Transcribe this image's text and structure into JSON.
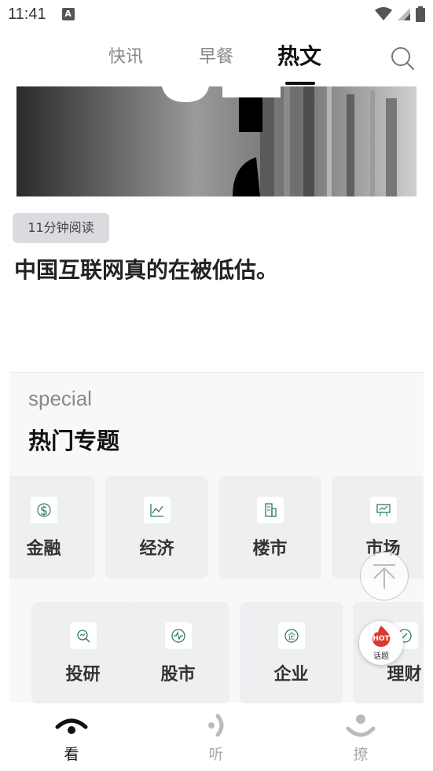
{
  "status_bar": {
    "time": "11:41",
    "notification_icon_letter": "A"
  },
  "top_tabs": [
    {
      "label": "快讯"
    },
    {
      "label": "早餐"
    },
    {
      "label": "热文"
    }
  ],
  "article": {
    "read_time": "11分钟阅读",
    "headline": "中国互联网真的在被低估。"
  },
  "special": {
    "subtitle": "special",
    "title": "热门专题",
    "row1": [
      {
        "label": "金融",
        "icon": "dollar-icon"
      },
      {
        "label": "经济",
        "icon": "line-chart-icon"
      },
      {
        "label": "楼市",
        "icon": "building-icon"
      },
      {
        "label": "市场",
        "icon": "presentation-board-icon"
      }
    ],
    "row2": [
      {
        "label": "投研",
        "icon": "research-icon"
      },
      {
        "label": "股市",
        "icon": "stock-pulse-icon"
      },
      {
        "label": "企业",
        "icon": "enterprise-icon"
      },
      {
        "label": "理财",
        "icon": "wealth-icon"
      }
    ]
  },
  "floating": {
    "hot_badge_text": "HOT",
    "hot_label": "话题"
  },
  "bottom_nav": [
    {
      "label": "看",
      "active": true
    },
    {
      "label": "听",
      "active": false
    },
    {
      "label": "撩",
      "active": false
    }
  ],
  "colors": {
    "accent": "#111111",
    "tile_bg": "#eeeff1",
    "hot_red": "#d83a2e",
    "icon_green": "#2e7d5a"
  }
}
